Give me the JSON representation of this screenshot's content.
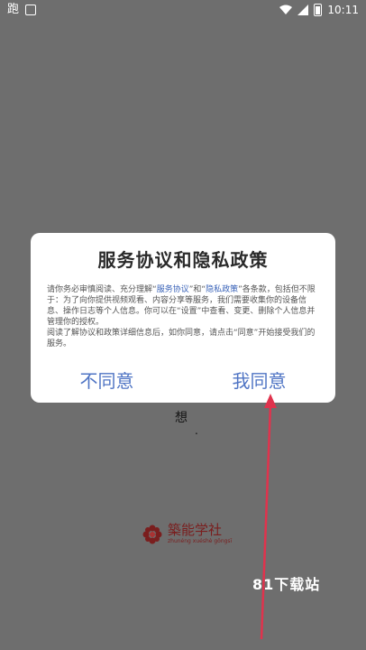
{
  "status_bar": {
    "time": "10:11",
    "left_icon_1": "跑",
    "left_icon_2": "notification"
  },
  "dialog": {
    "title": "服务协议和隐私政策",
    "body_parts": {
      "p1": "请你务必审慎阅读、充分理解",
      "link1": "服务协议",
      "and": "和",
      "link2": "隐私政策",
      "p2": "各条款，包括但不限于：为了向你提供视频观看、内容分享等服务，我们需要收集你的设备信息、操作日志等个人信息。你可以在“设置”中查看、变更、删除个人信息并管理你的授权。",
      "p3": "阅读了解协议和政策详细信息后，如你同意，请点击“同意”开始接受我们的服务。"
    },
    "decline_label": "不同意",
    "accept_label": "我同意"
  },
  "background": {
    "partial_text": "想",
    "logo_name": "築能学社",
    "logo_sub": "zhunéng xuéshè gōngsī"
  },
  "watermark": "81下载站",
  "colors": {
    "overlay_bg": "#6e6e6e",
    "accent": "#4f74c4",
    "arrow": "#e0334d",
    "logo": "#7a1e1e"
  }
}
